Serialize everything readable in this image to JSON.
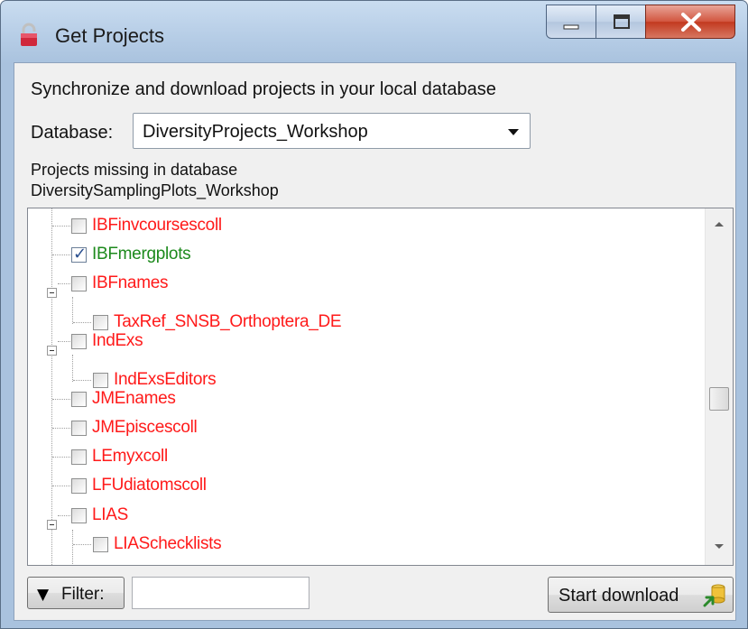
{
  "window": {
    "title": "Get Projects",
    "buttons": {
      "minimize": "minimize",
      "maximize": "maximize",
      "close": "close"
    }
  },
  "header": {
    "text": "Synchronize and download projects in your local database"
  },
  "database": {
    "label": "Database:",
    "selected": "DiversityProjects_Workshop"
  },
  "missing": {
    "line1": "Projects missing in database",
    "line2": "DiversitySamplingPlots_Workshop"
  },
  "tree": {
    "items": [
      {
        "label": "IBFinvcoursescoll",
        "checked": false,
        "level": 0,
        "color": "red"
      },
      {
        "label": "IBFmergplots",
        "checked": true,
        "level": 0,
        "color": "green"
      },
      {
        "label": "IBFnames",
        "checked": false,
        "level": 0,
        "color": "red",
        "expanded": true
      },
      {
        "label": "TaxRef_SNSB_Orthoptera_DE",
        "checked": false,
        "level": 1,
        "color": "red"
      },
      {
        "label": "IndExs",
        "checked": false,
        "level": 0,
        "color": "red",
        "expanded": true
      },
      {
        "label": "IndExsEditors",
        "checked": false,
        "level": 1,
        "color": "red"
      },
      {
        "label": "JMEnames",
        "checked": false,
        "level": 0,
        "color": "red"
      },
      {
        "label": "JMEpiscescoll",
        "checked": false,
        "level": 0,
        "color": "red"
      },
      {
        "label": "LEmyxcoll",
        "checked": false,
        "level": 0,
        "color": "red"
      },
      {
        "label": "LFUdiatomscoll",
        "checked": false,
        "level": 0,
        "color": "red"
      },
      {
        "label": "LIAS",
        "checked": false,
        "level": 0,
        "color": "red",
        "expanded": true
      },
      {
        "label": "LIASchecklists",
        "checked": false,
        "level": 1,
        "color": "red"
      }
    ]
  },
  "footer": {
    "filter_label": "Filter:",
    "filter_value": "",
    "start_label": "Start download"
  },
  "colors": {
    "missing_item": "#ff1a1a",
    "selected_item": "#1d8a1d"
  }
}
